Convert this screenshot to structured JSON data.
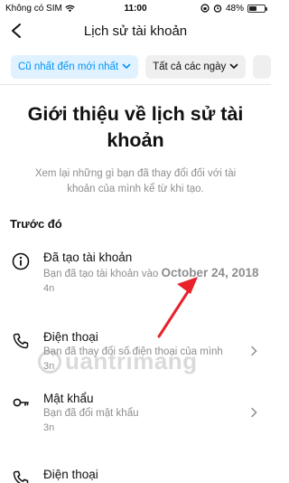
{
  "status_bar": {
    "carrier": "Không có SIM",
    "time": "11:00",
    "battery_text": "48%",
    "battery_level": 0.48
  },
  "header": {
    "title": "Lịch sử tài khoản"
  },
  "filters": {
    "sort_label": "Cũ nhất đến mới nhất",
    "date_label": "Tất cả các ngày"
  },
  "intro": {
    "title": "Giới thiệu về lịch sử tài khoản",
    "description": "Xem lại những gì bạn đã thay đổi đối với tài khoản của mình kể từ khi tạo."
  },
  "section": {
    "label": "Trước đó"
  },
  "items": [
    {
      "title": "Đã tạo tài khoản",
      "desc_prefix": "Bạn đã tạo tài khoản vào ",
      "desc_bold": "October 24, 2018",
      "time": "4n",
      "icon": "info-icon"
    },
    {
      "title": "Điện thoại",
      "desc": "Bạn đã thay đổi số điện thoại của mình",
      "time": "3n",
      "icon": "phone-icon"
    },
    {
      "title": "Mật khẩu",
      "desc": "Bạn đã đổi mật khẩu",
      "time": "3n",
      "icon": "key-icon"
    },
    {
      "title": "Điện thoại",
      "icon": "phone-icon"
    }
  ],
  "watermark": {
    "text": "uantrimang"
  },
  "colors": {
    "accent": "#0095f6",
    "chip_active_bg": "#e0f1ff",
    "arrow": "#e8212b"
  }
}
